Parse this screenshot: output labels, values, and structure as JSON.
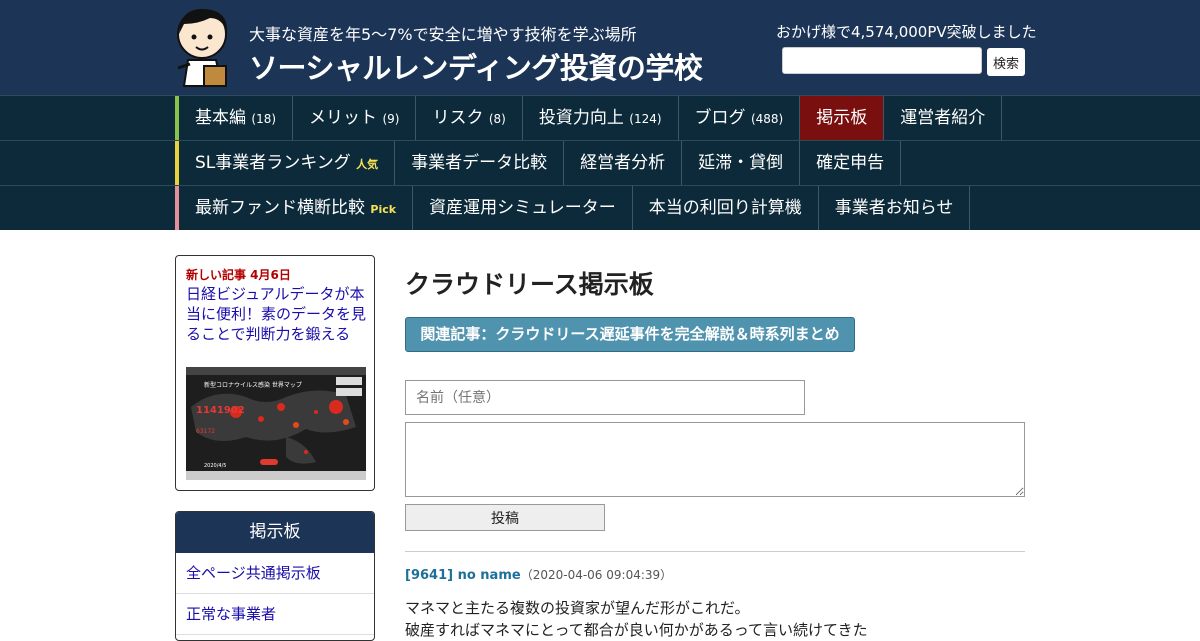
{
  "header": {
    "tagline": "大事な資産を年5～7%で安全に増やす技術を学ぶ場所",
    "title": "ソーシャルレンディング投資の学校",
    "pv_text": "おかげ様で4,574,000PV突破しました",
    "search_placeholder": "",
    "search_button": "検索",
    "logo_icon": "mascot-character-icon"
  },
  "nav": {
    "row1": [
      {
        "label": "基本編",
        "count": "(18)"
      },
      {
        "label": "メリット",
        "count": "(9)"
      },
      {
        "label": "リスク",
        "count": "(8)"
      },
      {
        "label": "投資力向上",
        "count": "(124)"
      },
      {
        "label": "ブログ",
        "count": "(488)"
      },
      {
        "label": "掲示板",
        "count": ""
      },
      {
        "label": "運営者紹介",
        "count": ""
      }
    ],
    "row2": [
      {
        "label": "SL事業者ランキング",
        "tag": "人気"
      },
      {
        "label": "事業者データ比較",
        "tag": ""
      },
      {
        "label": "経営者分析",
        "tag": ""
      },
      {
        "label": "延滞・貸倒",
        "tag": ""
      },
      {
        "label": "確定申告",
        "tag": ""
      }
    ],
    "row3": [
      {
        "label": "最新ファンド横断比較",
        "tag": "Pick"
      },
      {
        "label": "資産運用シミュレーター",
        "tag": ""
      },
      {
        "label": "本当の利回り計算機",
        "tag": ""
      },
      {
        "label": "事業者お知らせ",
        "tag": ""
      }
    ],
    "colors": {
      "active": "#7a0f10",
      "row1_accent": "#8bc34a",
      "row2_accent": "#e8d13a",
      "row3_accent": "#e58f9a"
    }
  },
  "sidebar": {
    "new_label": "新しい記事 4月6日",
    "new_title": "日経ビジュアルデータが本当に便利！素のデータを見ることで判断力を鍛える",
    "thumb": {
      "heading": "新型コロナウイルス感染 世界マップ",
      "big_number": "1141902",
      "small_number": "63172",
      "date": "2020/4/5"
    },
    "board_heading": "掲示板",
    "board_links": [
      "全ページ共通掲示板",
      "正常な事業者"
    ]
  },
  "main": {
    "title": "クラウドリース掲示板",
    "related_button": "関連記事：クラウドリース遅延事件を完全解説＆時系列まとめ",
    "name_placeholder": "名前（任意）",
    "post_button": "投稿",
    "comment": {
      "author": "[9641] no name",
      "date": "（2020-04-06 09:04:39）",
      "lines": [
        "マネマと主たる複数の投資家が望んだ形がこれだ。",
        "破産すればマネマにとって都合が良い何かがあるって言い続けてきた"
      ]
    }
  }
}
